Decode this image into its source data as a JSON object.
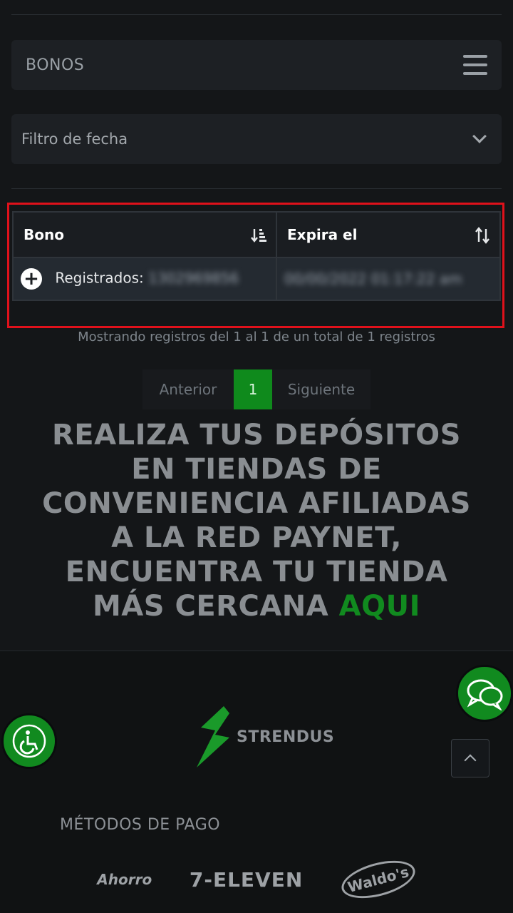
{
  "menu": {
    "title": "BONOS"
  },
  "filter": {
    "label": "Filtro de fecha"
  },
  "table": {
    "headers": [
      "Bono",
      "Expira el"
    ],
    "rows": [
      {
        "label": "Registrados:",
        "bono_value": "1302969856",
        "expires": "00/00/2022 01:17:22 am"
      }
    ]
  },
  "info": {
    "text": "Mostrando registros del 1 al 1 de un total de 1 registros"
  },
  "pager": {
    "prev": "Anterior",
    "current": "1",
    "next": "Siguiente"
  },
  "promo": {
    "text": "REALIZA TUS DEPÓSITOS EN TIENDAS DE CONVENIENCIA AFILIADAS A LA RED PAYNET, ENCUENTRA TU TIENDA MÁS CERCANA",
    "link": "AQUI"
  },
  "footer": {
    "brand": "STRENDUS",
    "payment_title": "MÉTODOS DE PAGO",
    "payment_logos": [
      "Ahorro",
      "7-ELEVEN",
      "Waldo's"
    ]
  },
  "colors": {
    "accent": "#118a1f",
    "highlight": "#e0111b"
  }
}
